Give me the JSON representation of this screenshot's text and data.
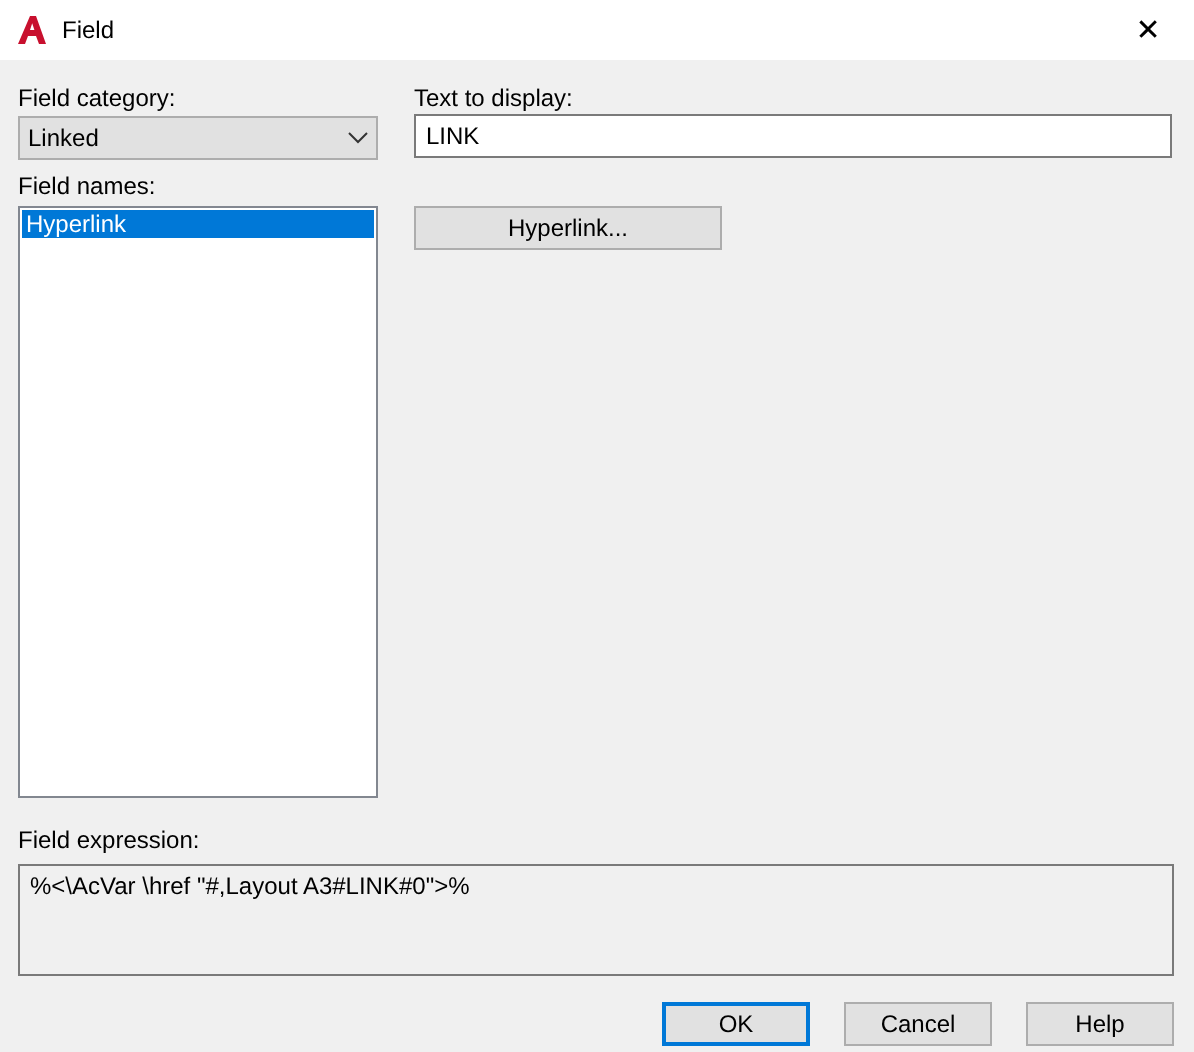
{
  "window": {
    "title": "Field",
    "close": "✕"
  },
  "field_category": {
    "label": "Field category:",
    "value": "Linked"
  },
  "field_names": {
    "label": "Field names:",
    "items": [
      {
        "label": "Hyperlink",
        "selected": true
      }
    ]
  },
  "text_to_display": {
    "label": "Text to display:",
    "value": "LINK"
  },
  "hyperlink_button": "Hyperlink...",
  "field_expression": {
    "label": "Field expression:",
    "value": "%<\\AcVar \\href \"#,Layout A3#LINK#0\">%"
  },
  "buttons": [
    {
      "label": "OK",
      "default": true
    },
    {
      "label": "Cancel",
      "default": false
    },
    {
      "label": "Help",
      "default": false
    }
  ]
}
